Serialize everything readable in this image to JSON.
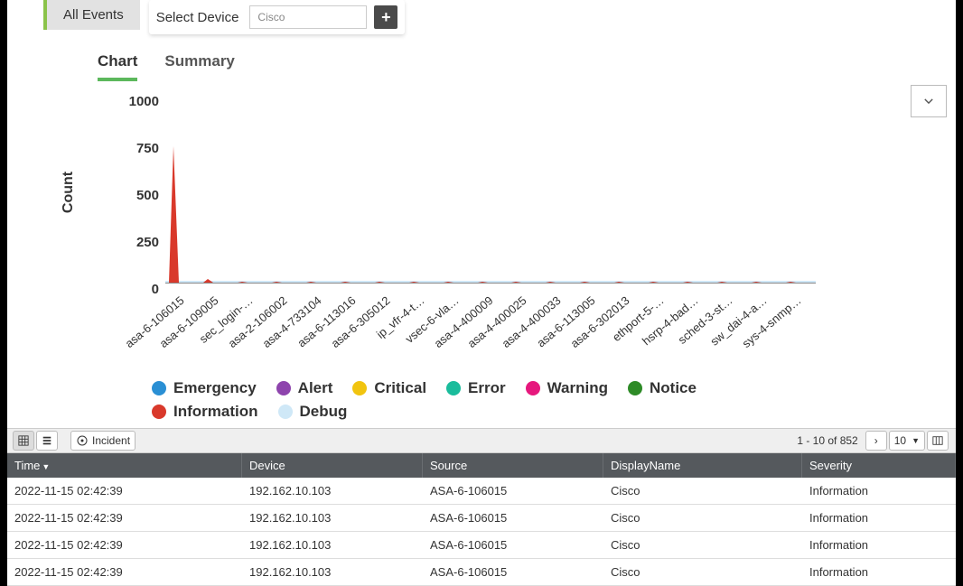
{
  "header": {
    "all_events": "All Events",
    "select_device": "Select Device",
    "device_value": "Cisco"
  },
  "tabs": {
    "chart": "Chart",
    "summary": "Summary"
  },
  "toolbar": {
    "incident": "Incident",
    "pager": "1 - 10 of 852",
    "pagesize": "10"
  },
  "columns": {
    "time": "Time",
    "device": "Device",
    "source": "Source",
    "display": "DisplayName",
    "severity": "Severity"
  },
  "rows": [
    {
      "time": "2022-11-15 02:42:39",
      "device": "192.162.10.103",
      "source": "ASA-6-106015",
      "display": "Cisco",
      "severity": "Information"
    },
    {
      "time": "2022-11-15 02:42:39",
      "device": "192.162.10.103",
      "source": "ASA-6-106015",
      "display": "Cisco",
      "severity": "Information"
    },
    {
      "time": "2022-11-15 02:42:39",
      "device": "192.162.10.103",
      "source": "ASA-6-106015",
      "display": "Cisco",
      "severity": "Information"
    },
    {
      "time": "2022-11-15 02:42:39",
      "device": "192.162.10.103",
      "source": "ASA-6-106015",
      "display": "Cisco",
      "severity": "Information"
    }
  ],
  "chart_data": {
    "type": "bar",
    "ylabel": "Count",
    "ylim": [
      0,
      1000
    ],
    "yticks": [
      1000,
      750,
      500,
      250,
      0
    ],
    "categories": [
      "asa-6-106015",
      "asa-6-109005",
      "sec_login-…",
      "asa-2-106002",
      "asa-4-733104",
      "asa-6-113016",
      "asa-6-305012",
      "ip_vfr-4-t…",
      "vsec-6-vla…",
      "asa-4-400009",
      "asa-4-400025",
      "asa-4-400033",
      "asa-6-113005",
      "asa-6-302013",
      "ethport-5-…",
      "hsrp-4-bad…",
      "sched-3-st…",
      "sw_dai-4-a…",
      "sys-4-snmp…"
    ],
    "series": [
      {
        "name": "Emergency",
        "color": "#2a8fd4",
        "values": [
          0,
          0,
          0,
          0,
          0,
          0,
          0,
          0,
          0,
          0,
          0,
          0,
          0,
          0,
          0,
          0,
          0,
          0,
          0
        ]
      },
      {
        "name": "Alert",
        "color": "#8e44ad",
        "values": [
          0,
          0,
          0,
          0,
          0,
          0,
          0,
          0,
          0,
          0,
          0,
          0,
          0,
          0,
          0,
          0,
          0,
          0,
          0
        ]
      },
      {
        "name": "Critical",
        "color": "#f1c40f",
        "values": [
          0,
          0,
          0,
          0,
          0,
          0,
          0,
          0,
          0,
          0,
          0,
          0,
          0,
          0,
          0,
          0,
          0,
          0,
          0
        ]
      },
      {
        "name": "Error",
        "color": "#1abc9c",
        "values": [
          0,
          0,
          0,
          0,
          0,
          0,
          0,
          0,
          0,
          0,
          0,
          0,
          0,
          0,
          0,
          0,
          0,
          0,
          0
        ]
      },
      {
        "name": "Warning",
        "color": "#e6187d",
        "values": [
          0,
          0,
          0,
          0,
          0,
          0,
          0,
          0,
          0,
          0,
          0,
          0,
          0,
          0,
          0,
          0,
          0,
          0,
          0
        ]
      },
      {
        "name": "Notice",
        "color": "#2e8b27",
        "values": [
          0,
          0,
          0,
          0,
          0,
          0,
          0,
          0,
          0,
          0,
          0,
          0,
          0,
          0,
          0,
          0,
          0,
          0,
          0
        ]
      },
      {
        "name": "Information",
        "color": "#d9392b",
        "values": [
          730,
          20,
          5,
          5,
          5,
          5,
          5,
          5,
          5,
          5,
          5,
          5,
          5,
          5,
          5,
          5,
          5,
          5,
          5
        ]
      },
      {
        "name": "Debug",
        "color": "#cfe8f7",
        "values": [
          0,
          0,
          0,
          0,
          0,
          0,
          0,
          0,
          0,
          0,
          0,
          0,
          0,
          0,
          0,
          0,
          0,
          0,
          0
        ]
      }
    ]
  }
}
